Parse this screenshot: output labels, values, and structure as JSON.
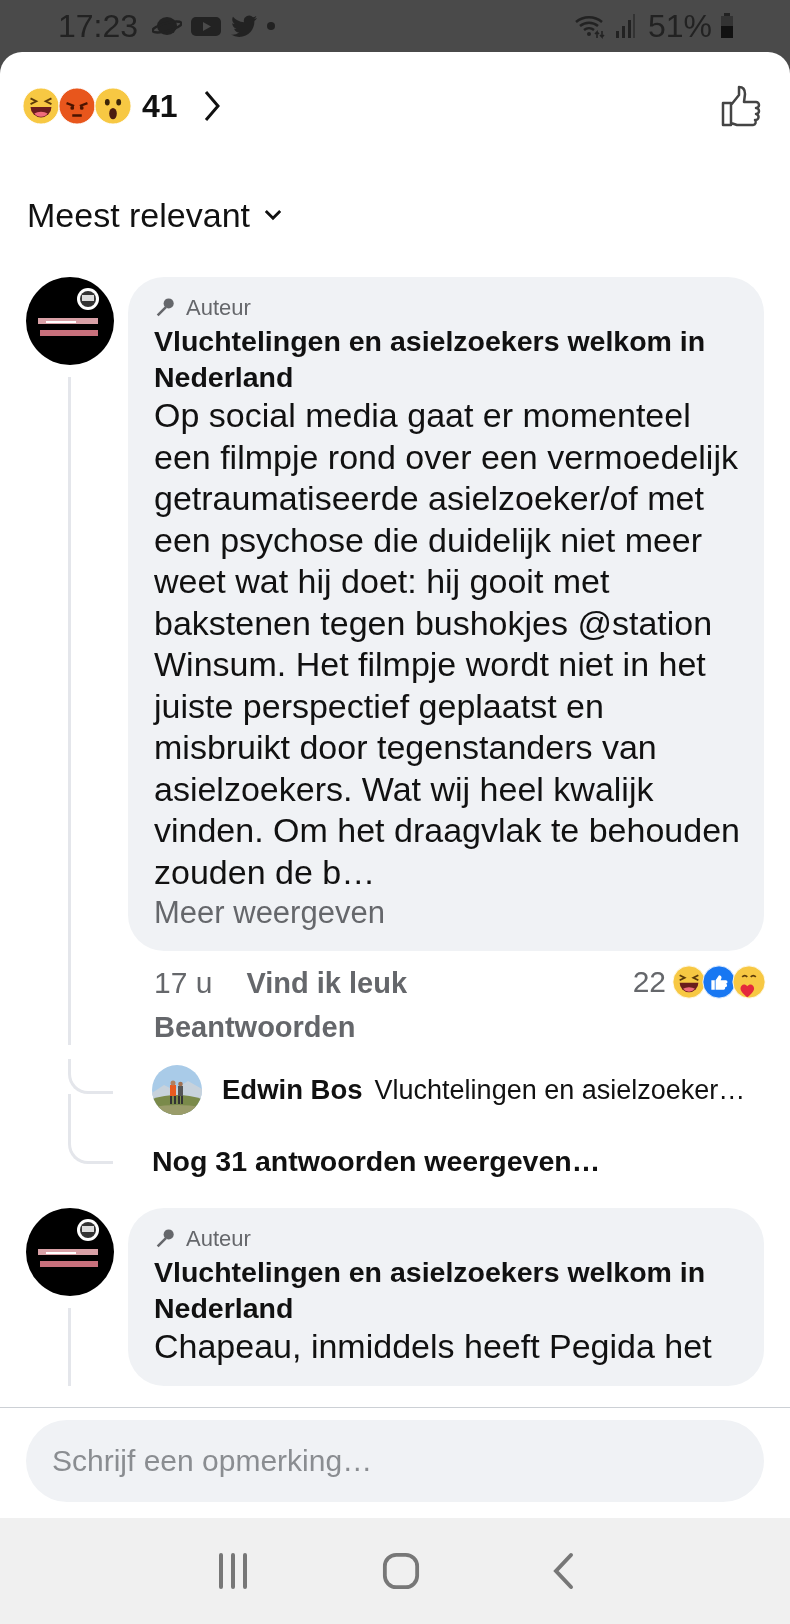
{
  "status_bar": {
    "time": "17:23",
    "battery": "51%"
  },
  "reactions_summary": {
    "count": "41"
  },
  "sort": {
    "label": "Meest relevant"
  },
  "comments": [
    {
      "badge": "Auteur",
      "author": "Vluchtelingen en asielzoekers welkom in Nederland",
      "body": "Op social media gaat er momenteel een filmpje rond over een vermoedelijk getraumatiseerde asielzoeker/of met een psychose die duidelijk niet meer weet wat hij doet: hij gooit met bakstenen tegen bushokjes @station Winsum. Het filmpje wordt niet in het juiste perspectief geplaatst en misbruikt door tegenstanders van asielzoekers. Wat wij heel kwalijk vinden. Om het draagvlak te behouden zouden de b…",
      "more": "Meer weergeven",
      "time": "17 u",
      "like": "Vind ik leuk",
      "reply": "Beantwoorden",
      "reaction_count": "22",
      "replies": [
        {
          "author": "Edwin Bos",
          "text": "Vluchtelingen en asielzoeker…"
        }
      ],
      "more_replies": "Nog 31 antwoorden weergeven…"
    },
    {
      "badge": "Auteur",
      "author": "Vluchtelingen en asielzoekers welkom in Nederland",
      "body": "Chapeau, inmiddels heeft Pegida het"
    }
  ],
  "composer": {
    "placeholder": "Schrijf een opmerking…"
  }
}
